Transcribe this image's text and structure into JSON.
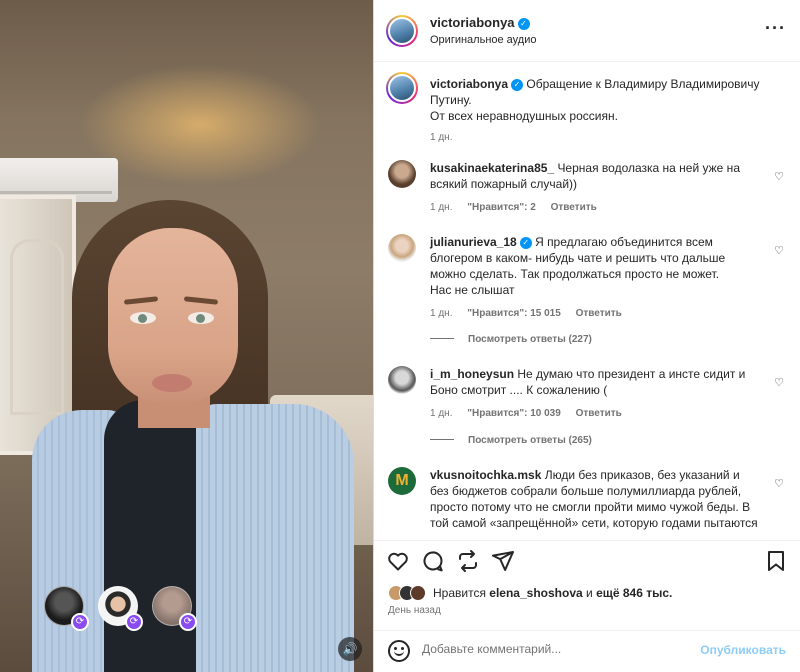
{
  "post": {
    "username": "victoriabonya",
    "audio": "Оригинальное аудио",
    "more_icon": "more-horizontal-icon",
    "caption": "Обращение к Владимиру Владимировичу Путину.",
    "caption_line2": "От всех неравнодушных россиян.",
    "caption_time": "1 дн."
  },
  "video": {
    "participants": [
      "participant-1",
      "participant-2",
      "participant-3"
    ],
    "volume_icon": "speaker-icon"
  },
  "comments": [
    {
      "username": "kusakinaekaterina85_",
      "text": "Черная водолазка на ней уже на всякий пожарный случай))",
      "time": "1 дн.",
      "likes": "\"Нравится\": 2",
      "reply": "Ответить",
      "verified": false
    },
    {
      "username": "julianurieva_18",
      "text": "Я предлагаю объединится всем блогером в каком- нибудь чате и решить что дальше можно сделать. Так продолжаться просто не может.",
      "text2": "Нас не слышат",
      "time": "1 дн.",
      "likes": "\"Нравится\": 15 015",
      "reply": "Ответить",
      "replies": "Посмотреть ответы (227)",
      "verified": true
    },
    {
      "username": "i_m_honeysun",
      "text": "Не думаю что президент а инсте сидит и Боно смотрит .... К сожалению (",
      "time": "1 дн.",
      "likes": "\"Нравится\": 10 039",
      "reply": "Ответить",
      "replies": "Посмотреть ответы (265)",
      "verified": false
    },
    {
      "username": "vkusnoitochka.msk",
      "text": "Люди без приказов, без указаний и без бюджетов собрали больше полумиллиарда рублей, просто потому что не смогли пройти мимо чужой беды. В той самой «запрещённой» сети, которую годами пытаются",
      "verified": false
    }
  ],
  "actions": {
    "likes_prefix": "Нравится",
    "likes_user": "elena_shoshova",
    "likes_and": "и",
    "likes_rest": "ещё 846 тыс.",
    "time_ago": "День назад"
  },
  "add_comment": {
    "placeholder": "Добавьте комментарий...",
    "publish": "Опубликовать"
  },
  "colors": {
    "accent": "#0095f6",
    "publish_disabled": "#8ecdf8",
    "secondary_text": "#737373"
  }
}
